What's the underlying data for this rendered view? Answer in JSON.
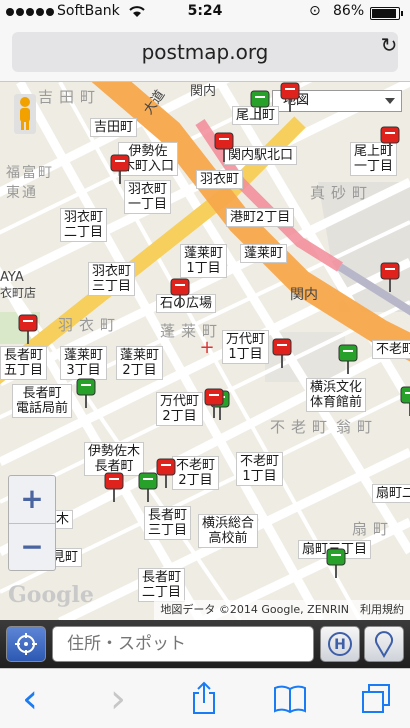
{
  "status_bar": {
    "carrier": "SoftBank",
    "time": "5:24",
    "battery_percent": "86%",
    "battery_level": 0.86
  },
  "browser": {
    "url": "postmap.org",
    "reload_icon": "reload-icon"
  },
  "map": {
    "map_type": "地図",
    "zoom_in": "+",
    "zoom_out": "−",
    "logo": "Google",
    "copyright": "地図データ ©2014 Google, ZENRIN　利用規約",
    "districts": [
      "羽衣町",
      "蓬莱町",
      "不老町",
      "翁町",
      "真砂町",
      "福富町東通",
      "扇町",
      "吉田町"
    ],
    "road_labels": [
      "関内",
      "関内",
      "大道",
      "AYA",
      "衣町店"
    ],
    "place_labels": [
      "吉田町",
      "伊勢佐\n木町入口",
      "羽衣町",
      "関内駅北口",
      "羽衣町\n一丁目",
      "尾上町",
      "尾上町\n一丁目",
      "港町2丁目",
      "羽衣町\n二丁目",
      "蓬莱町\n1丁目",
      "蓬莱町",
      "羽衣町\n三丁目",
      "石の広場",
      "万代町\n1丁目",
      "長者町\n五丁目",
      "蓬莱町\n3丁目",
      "蓬莱町\n2丁目",
      "不老町",
      "横浜文化\n体育館前",
      "長者町\n電話局前",
      "万代町\n2丁目",
      "伊勢佐木\n長者町",
      "不老町\n1丁目",
      "不老町\n2丁目",
      "扇町二",
      "長者町\n三丁目",
      "横浜総合\n高校前",
      "扇町三丁目",
      "長者町\n二丁目",
      "見町",
      "木"
    ]
  },
  "search": {
    "placeholder": "住所・スポット"
  },
  "toolbar": {
    "back": "‹",
    "forward": "›"
  }
}
